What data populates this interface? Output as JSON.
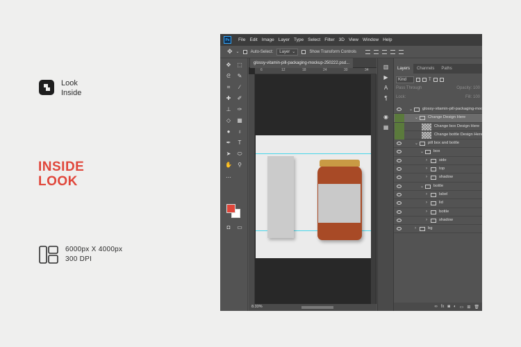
{
  "promo": {
    "brand_line1": "Look",
    "brand_line2": "Inside",
    "headline_line1": "INSIDE",
    "headline_line2": "LOOK",
    "dimensions": "6000px X 4000px",
    "dpi": "300 DPI",
    "accent_color": "#e0463a"
  },
  "ps": {
    "logo": "Ps",
    "menu": [
      "File",
      "Edit",
      "Image",
      "Layer",
      "Type",
      "Select",
      "Filter",
      "3D",
      "View",
      "Window",
      "Help"
    ],
    "options": {
      "auto_select": "Auto-Select:",
      "target": "Layer",
      "show_transform": "Show Transform Controls"
    },
    "document_tab": "glossy-vitamin-pill-packaging-mockup-250222.psd...",
    "ruler_marks": [
      "6",
      "12",
      "18",
      "24",
      "30",
      "34"
    ],
    "zoom": "8.33%",
    "foreground_color": "#e0463a",
    "background_color": "#ffffff"
  },
  "layers_panel": {
    "tabs": [
      "Layers",
      "Channels",
      "Paths"
    ],
    "kind": "Kind",
    "blend_mode": "Pass Through",
    "opacity_label": "Opacity:",
    "opacity_value": "100",
    "lock_label": "Lock:",
    "fill_label": "Fill:",
    "fill_value": "100",
    "layers": [
      {
        "name": "glossy-vitamin-pill-packaging-mockup",
        "type": "folder",
        "indent": 0,
        "expanded": true
      },
      {
        "name": "Change Design Here",
        "type": "folder",
        "indent": 1,
        "expanded": true,
        "selected": true
      },
      {
        "name": "Change box Design Here",
        "type": "smart",
        "indent": 2
      },
      {
        "name": "Change bottle Design Here",
        "type": "smart",
        "indent": 2
      },
      {
        "name": "pill box and bottle",
        "type": "folder",
        "indent": 1,
        "expanded": true
      },
      {
        "name": "box",
        "type": "folder",
        "indent": 2,
        "expanded": true
      },
      {
        "name": "side",
        "type": "folder",
        "indent": 3
      },
      {
        "name": "top",
        "type": "folder",
        "indent": 3
      },
      {
        "name": "shadow",
        "type": "folder",
        "indent": 3
      },
      {
        "name": "bottle",
        "type": "folder",
        "indent": 2,
        "expanded": true
      },
      {
        "name": "label",
        "type": "folder",
        "indent": 3
      },
      {
        "name": "lid",
        "type": "folder",
        "indent": 3
      },
      {
        "name": "bottle",
        "type": "folder",
        "indent": 3
      },
      {
        "name": "shadow",
        "type": "folder",
        "indent": 3
      },
      {
        "name": "bg",
        "type": "folder",
        "indent": 1
      }
    ],
    "footer_icons": [
      "link-icon",
      "fx-icon",
      "mask-icon",
      "adjustment-icon",
      "folder-icon",
      "new-layer-icon",
      "trash-icon"
    ]
  }
}
